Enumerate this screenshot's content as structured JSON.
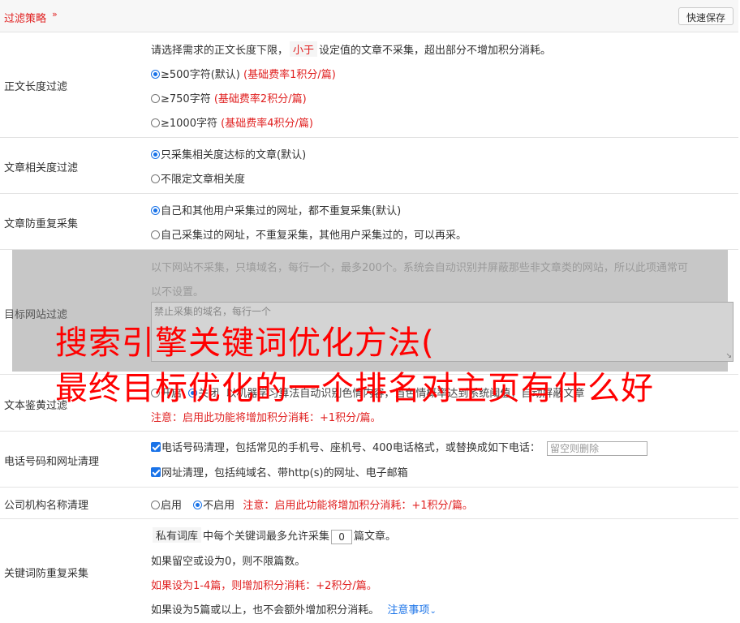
{
  "header": {
    "title": "过滤策略",
    "chevron_icon": "double-chevron-down",
    "save_label": "快速保存"
  },
  "length_filter": {
    "label": "正文长度过滤",
    "desc_before": "请选择需求的正文长度下限，",
    "desc_tag": "小于",
    "desc_after": "设定值的文章不采集，超出部分不增加积分消耗。",
    "options": [
      {
        "text": "≥500字符(默认)",
        "note": "(基础费率1积分/篇)",
        "selected": true
      },
      {
        "text": "≥750字符",
        "note": "(基础费率2积分/篇)",
        "selected": false
      },
      {
        "text": "≥1000字符",
        "note": "(基础费率4积分/篇)",
        "selected": false
      }
    ]
  },
  "relevance_filter": {
    "label": "文章相关度过滤",
    "options": [
      {
        "text": "只采集相关度达标的文章(默认)",
        "selected": true
      },
      {
        "text": "不限定文章相关度",
        "selected": false
      }
    ]
  },
  "dup_filter": {
    "label": "文章防重复采集",
    "options": [
      {
        "text": "自己和其他用户采集过的网址，都不重复采集(默认)",
        "selected": true
      },
      {
        "text": "自己采集过的网址，不重复采集，其他用户采集过的，可以再采。",
        "selected": false
      }
    ]
  },
  "site_filter": {
    "label": "目标网站过滤",
    "desc_line1": "以下网站不采集，只填域名，每行一个，最多200个。系统会自动识别并屏蔽那些非文章类的网站，所以此项通常可",
    "desc_line2": "以不设置。",
    "placeholder": "禁止采集的域名，每行一个"
  },
  "porn_filter": {
    "label": "文本鉴黄过滤",
    "option_on": "开启",
    "option_off": "关闭",
    "hidden_desc": "以机器学习算法自动识别色情内容，当色情概率达到系统阈值，自动屏蔽文章",
    "on_selected": false,
    "note": "注意：启用此功能将增加积分消耗：+1积分/篇。"
  },
  "phone_filter": {
    "label": "电话号码和网址清理",
    "phone_text": "电话号码清理，包括常见的手机号、座机号、400电话格式，或替换成如下电话：",
    "phone_placeholder": "留空则删除",
    "phone_checked": true,
    "url_text": "网址清理，包括纯域名、带http(s)的网址、电子邮箱",
    "url_checked": true
  },
  "company_filter": {
    "label": "公司机构名称清理",
    "option_on": "启用",
    "option_off": "不启用",
    "on_selected": false,
    "note": "注意：启用此功能将增加积分消耗：+1积分/篇。"
  },
  "keyword_filter": {
    "label": "关键词防重复采集",
    "tag": "私有词库",
    "text_before": "中每个关键词最多允许采集",
    "value": "0",
    "text_after": "篇文章。",
    "line2": "如果留空或设为0，则不限篇数。",
    "line3": "如果设为1-4篇，则增加积分消耗：+2积分/篇。",
    "line4": "如果设为5篇或以上，也不会额外增加积分消耗。",
    "link": "注意事项",
    "link_icon": "chevron-down"
  },
  "overlay": {
    "line1": "搜索引擎关键词优化方法(",
    "line2": "最终目标优化的一个排名对主页有什么好"
  },
  "colors": {
    "accent_red": "#e02020",
    "overlay_red": "#ff0000",
    "link_blue": "#1a73e8",
    "gray_overlay": "#c7c7c7"
  }
}
